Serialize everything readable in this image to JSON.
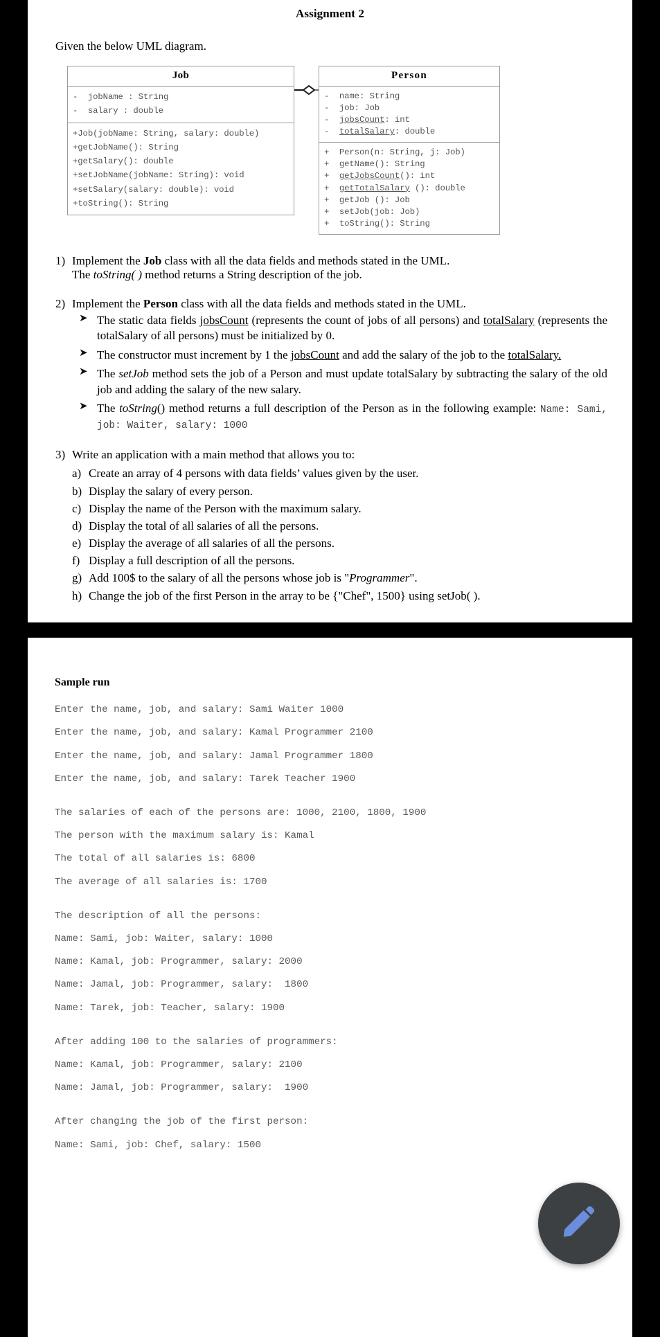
{
  "document": {
    "title": "Assignment 2",
    "intro": "Given the below UML diagram."
  },
  "uml": {
    "job": {
      "title": "Job",
      "fields": [
        "-  jobName : String",
        "-  salary : double"
      ],
      "methods": [
        "+Job(jobName: String, salary: double)",
        "+getJobName(): String",
        "+getSalary(): double",
        "+setJobName(jobName: String): void",
        "+setSalary(salary: double): void",
        "+toString(): String"
      ]
    },
    "person": {
      "title": "Person",
      "fields": [
        "-  name: String",
        "-  job: Job",
        "-  jobsCount: int",
        "-  totalSalary: double"
      ],
      "underlined_fields": [
        "jobsCount",
        "totalSalary"
      ],
      "methods": [
        "+  Person(n: String, j: Job)",
        "+  getName(): String",
        "+  getJobsCount(): int",
        "+  getTotalSalary (): double",
        "+  getJob (): Job",
        "+  setJob(job: Job)",
        "+  toString(): String"
      ],
      "underlined_methods": [
        "getJobsCount",
        "getTotalSalary"
      ],
      "relation": "aggregation-diamond"
    }
  },
  "tasks": [
    {
      "num": "1)",
      "line1_pre": "Implement the ",
      "line1_bold": "Job",
      "line1_post": " class with all the data fields and methods stated in the UML.",
      "line2_pre": "The ",
      "line2_ital": "toString( )",
      "line2_post": " method returns a String description of the job."
    },
    {
      "num": "2)",
      "line1_pre": "Implement the ",
      "line1_bold": "Person",
      "line1_post": " class with all the data fields and methods stated in the UML.",
      "bullets": [
        {
          "parts": [
            {
              "t": "The static data fields ",
              "s": "plain"
            },
            {
              "t": "jobsCount",
              "s": "underline"
            },
            {
              "t": " (represents the count of jobs of all persons) and ",
              "s": "plain"
            },
            {
              "t": "totalSalary",
              "s": "underline"
            },
            {
              "t": " (represents the totalSalary of all persons) must be initialized by 0.",
              "s": "plain"
            }
          ]
        },
        {
          "parts": [
            {
              "t": "The constructor must increment by 1 the ",
              "s": "plain"
            },
            {
              "t": "jobsCount",
              "s": "underline"
            },
            {
              "t": " and add the salary of the job to the ",
              "s": "plain"
            },
            {
              "t": "totalSalary.",
              "s": "underline"
            }
          ]
        },
        {
          "parts": [
            {
              "t": "The ",
              "s": "plain"
            },
            {
              "t": "setJob",
              "s": "italic"
            },
            {
              "t": " method sets the job of a Person and must update totalSalary by subtracting the salary of the old job and adding the salary of the new salary.",
              "s": "plain"
            }
          ]
        },
        {
          "parts": [
            {
              "t": "The ",
              "s": "plain"
            },
            {
              "t": "toString",
              "s": "italic"
            },
            {
              "t": "() method returns a full description of the Person as in the following example: ",
              "s": "plain"
            },
            {
              "t": "Name: Sami, job: Waiter, salary: 1000",
              "s": "mono"
            }
          ]
        }
      ]
    },
    {
      "num": "3)",
      "line1_pre": "Write an application with a main method that allows you to:",
      "sublist": [
        {
          "letter": "a)",
          "text": "Create an array of 4 persons with data fields’ values given by the user."
        },
        {
          "letter": "b)",
          "text": "Display the salary of every person."
        },
        {
          "letter": "c)",
          "text": "Display the name of the Person with the maximum salary."
        },
        {
          "letter": "d)",
          "text": "Display the total of all salaries of all the persons."
        },
        {
          "letter": "e)",
          "text": "Display the average of all salaries of all the persons."
        },
        {
          "letter": "f)",
          "text": "Display a full description of all the persons."
        },
        {
          "letter": "g)",
          "text": "Add 100$ to the salary of all the persons whose job is \"Programmer\"."
        },
        {
          "letter": "h)",
          "text": "Change the job of the first Person in the array to be {\"Chef\", 1500} using setJob( )."
        }
      ]
    }
  ],
  "sample_run": {
    "heading": "Sample run",
    "lines": [
      "Enter the name, job, and salary: Sami Waiter 1000",
      "Enter the name, job, and salary: Kamal Programmer 2100",
      "Enter the name, job, and salary: Jamal Programmer 1800",
      "Enter the name, job, and salary: Tarek Teacher 1900",
      "",
      "The salaries of each of the persons are: 1000, 2100, 1800, 1900",
      "The person with the maximum salary is: Kamal",
      "The total of all salaries is: 6800",
      "The average of all salaries is: 1700",
      "",
      "The description of all the persons:",
      "Name: Sami, job: Waiter, salary: 1000",
      "Name: Kamal, job: Programmer, salary: 2000",
      "Name: Jamal, job: Programmer, salary:  1800",
      "Name: Tarek, job: Teacher, salary: 1900",
      "",
      "After adding 100 to the salaries of programmers:",
      "Name: Kamal, job: Programmer, salary: 2100",
      "Name: Jamal, job: Programmer, salary:  1900",
      "",
      "After changing the job of the first person:",
      "Name: Sami, job: Chef, salary: 1500"
    ]
  },
  "fab": {
    "icon": "pencil-icon",
    "background": "#3c4043",
    "icon_color": "#6b8ddb"
  }
}
